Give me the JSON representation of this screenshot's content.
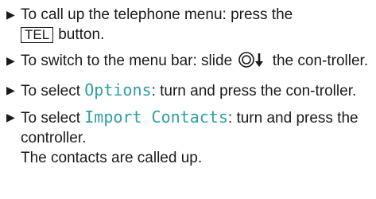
{
  "steps": [
    {
      "before": "To call up the telephone menu: press the",
      "key": "TEL",
      "after": "button."
    },
    {
      "before": "To switch to the menu bar: slide",
      "icon": "controller-slide-down-icon",
      "after": "the con-troller."
    },
    {
      "before": "To select",
      "menu": "Options",
      "after": ": turn and press the con-troller."
    },
    {
      "before": "To select",
      "menu": "Import Contacts",
      "after": ": turn and press the controller."
    }
  ],
  "result": "The contacts are called up."
}
